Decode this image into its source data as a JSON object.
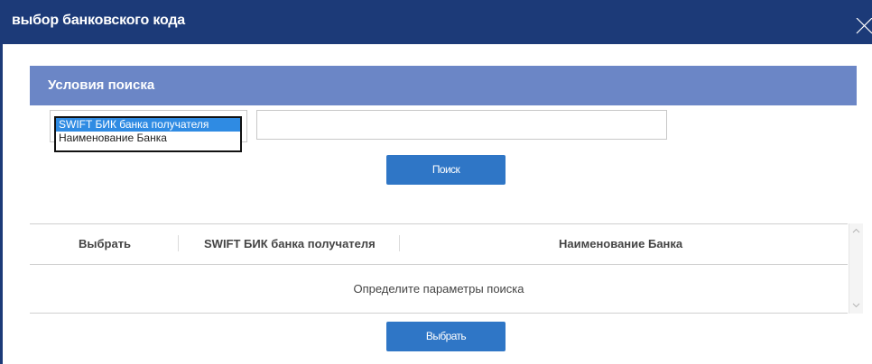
{
  "dialog": {
    "title": "выбор банковского кода"
  },
  "search": {
    "section_title": "Условия поиска",
    "options": [
      "SWIFT БИК банка получателя",
      "Наименование Банка"
    ],
    "selected_index": 0,
    "input_value": "",
    "search_label": "Поиск"
  },
  "table": {
    "columns": [
      "Выбрать",
      "SWIFT БИК банка получателя",
      "Наименование Банка"
    ],
    "empty_message": "Определите параметры поиска"
  },
  "footer": {
    "select_label": "Выбрать"
  },
  "colors": {
    "titlebar": "#1c3a78",
    "section_header": "#6b86c6",
    "button": "#2f76c6",
    "option_selected": "#2f8be3"
  }
}
